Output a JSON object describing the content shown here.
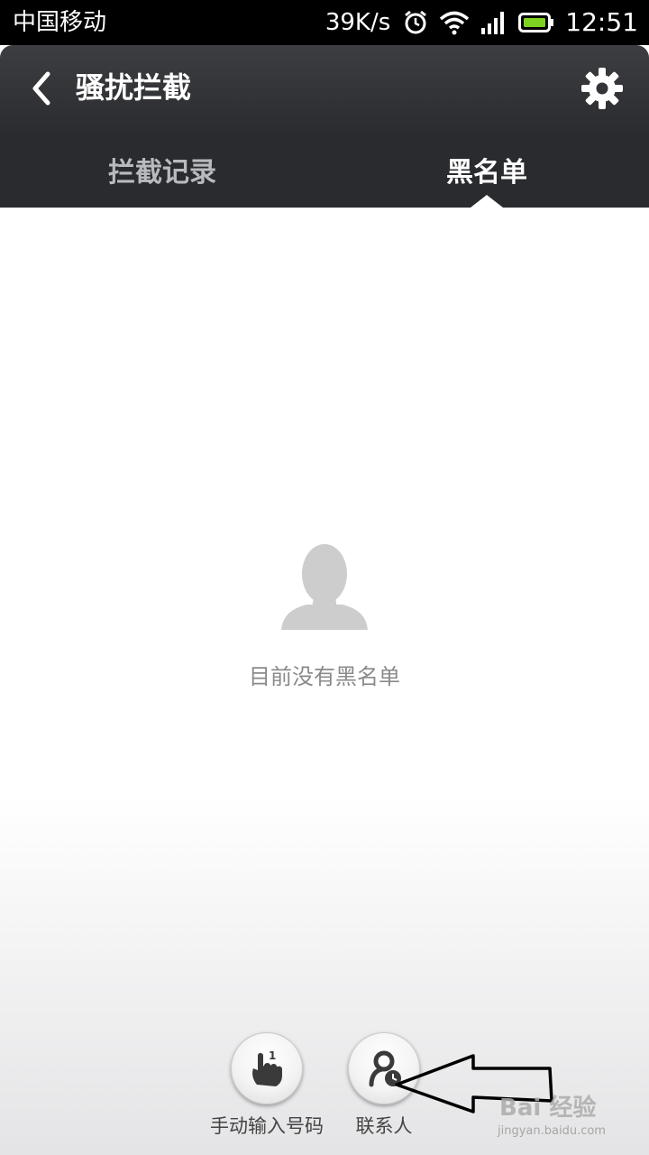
{
  "status_bar": {
    "carrier": "中国移动",
    "net_speed": "39K/s",
    "time": "12:51",
    "icons": [
      "alarm-icon",
      "wifi-icon",
      "signal-icon",
      "battery-icon"
    ],
    "battery_color": "#7ed321"
  },
  "header": {
    "title": "骚扰拦截",
    "back_icon": "chevron-left-icon",
    "settings_icon": "gear-icon"
  },
  "tabs": [
    {
      "label": "拦截记录",
      "active": false
    },
    {
      "label": "黑名单",
      "active": true
    }
  ],
  "empty_state": {
    "icon": "person-silhouette-icon",
    "message": "目前没有黑名单"
  },
  "actions": {
    "manual": {
      "label": "手动输入号码",
      "icon": "hand-number-icon"
    },
    "contacts": {
      "label": "联系人",
      "icon": "contact-icon"
    }
  },
  "watermark": {
    "brand": "Bai 经验",
    "url": "jingyan.baidu.com"
  },
  "colors": {
    "header_bg": "#2e2f33",
    "tab_bg": "#2a2b2e",
    "text_muted": "#8a8a8a",
    "icon_dark": "#3a3a3a"
  }
}
